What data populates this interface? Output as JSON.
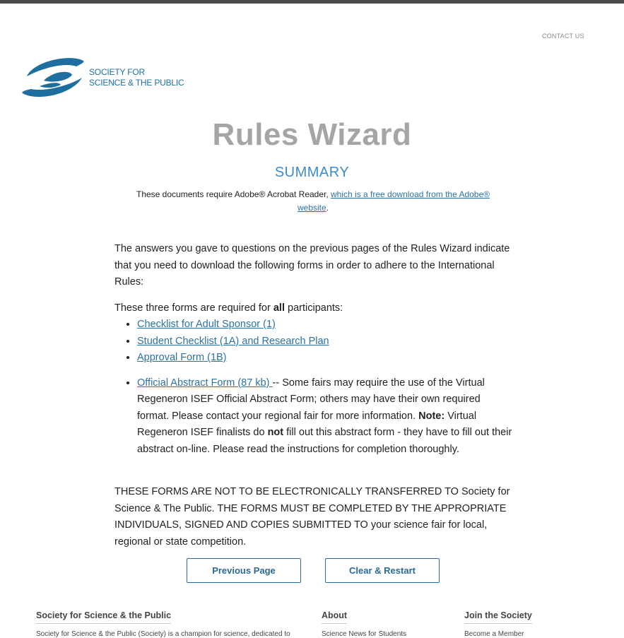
{
  "header": {
    "contact_label": "CONTACT US",
    "logo_line1": "SOCIETY FOR",
    "logo_line2": "SCIENCE & THE PUBLIC",
    "brand_color": "#1e6fa0"
  },
  "page": {
    "title": "Rules Wizard",
    "subtitle": "SUMMARY",
    "adobe_text": "These documents require Adobe® Acrobat Reader, ",
    "adobe_link": "which is a free download from the Adobe® website",
    "adobe_end": "."
  },
  "content": {
    "intro": "The answers you gave to questions on the previous pages of the Rules Wizard indicate that you need to download the following forms in order to adhere to the International Rules:",
    "required_prefix": "These three forms are required for ",
    "required_bold": "all",
    "required_suffix": " participants:",
    "forms": [
      "Checklist for Adult Sponsor (1)",
      "Student Checklist (1A) and Research Plan",
      "Approval Form (1B)"
    ],
    "abstract_link": "Official Abstract Form (87 kb) ",
    "abstract_text1": "-- Some fairs may require the use of the Virtual Regeneron ISEF Official Abstract Form; others may have their own required format. Please contact your regional fair for more information. ",
    "abstract_note_bold": "Note:",
    "abstract_text2": " Virtual Regeneron ISEF finalists do ",
    "abstract_not_bold": "not",
    "abstract_text3": " fill out this abstract form - they have to fill out their abstract on-line. Please read the instructions for completion thoroughly.",
    "warning": "THESE FORMS ARE NOT TO BE ELECTRONICALLY TRANSFERRED TO Society for Science & The Public.  THE FORMS MUST BE COMPLETED BY THE APPROPRIATE INDIVIDUALS, SIGNED AND COPIES SUBMITTED TO your science fair for local, regional or state competition."
  },
  "buttons": {
    "previous": "Previous Page",
    "clear": "Clear & Restart"
  },
  "footer": {
    "col1_heading": "Society for Science & the Public",
    "col1_text": "Society for Science & the Public (Society) is a champion for science, dedicated to",
    "col2_heading": "About",
    "col2_item": "Science News for Students",
    "col3_heading": "Join the Society",
    "col3_item": "Become a Member"
  }
}
